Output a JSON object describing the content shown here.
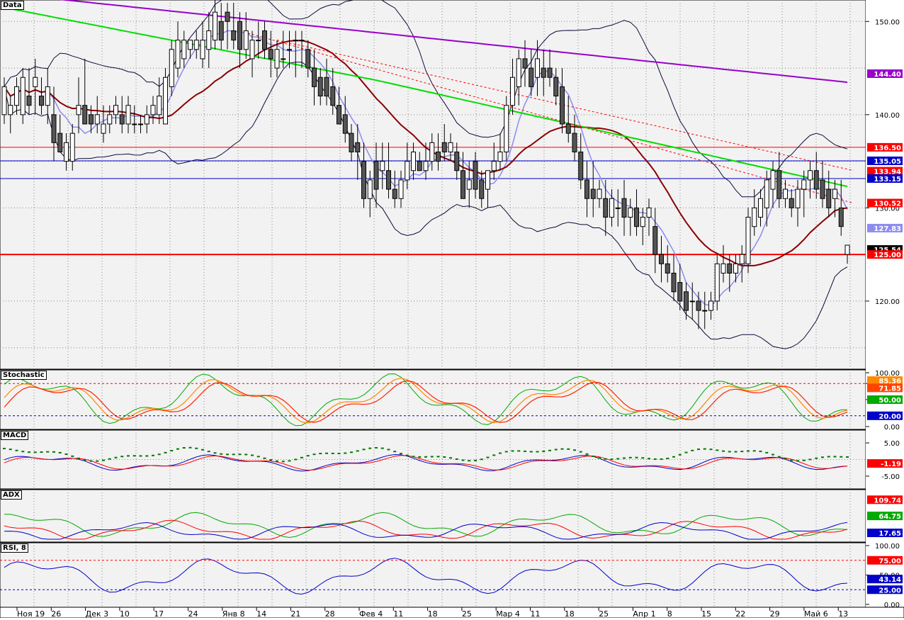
{
  "colors": {
    "background": "#f2f2f2",
    "bull": "#ffffff",
    "bear": "#555555",
    "bb": "#0a0a3a",
    "ma_fast": "#8c8cf0",
    "ma_mid": "#8b0000",
    "ma_slow": "#00dd00",
    "ma_long": "#9900cc"
  },
  "x_axis": {
    "labels": [
      "Ноя 19",
      "26",
      "Дек 3",
      "10",
      "17",
      "24",
      "Янв 8",
      "14",
      "21",
      "28",
      "Фев 4",
      "11",
      "18",
      "25",
      "Мар 4",
      "11",
      "18",
      "25",
      "Апр 1",
      "8",
      "15",
      "22",
      "29",
      "Май 6",
      "13"
    ]
  },
  "panels": {
    "data": {
      "title": "Data"
    },
    "stochastic": {
      "title": "Stochastic"
    },
    "macd": {
      "title": "MACD"
    },
    "adx": {
      "title": "ADX"
    },
    "rsi": {
      "title": "RSI, 8"
    }
  },
  "chart_data": [
    {
      "type": "candlestick",
      "panel": "Data",
      "ylim": [
        113,
        152
      ],
      "y_ticks": [
        "120.00",
        "130.00",
        "140.00",
        "150.00"
      ],
      "ohlc": [
        [
          140,
          144,
          139,
          143
        ],
        [
          140,
          142,
          138,
          141
        ],
        [
          141,
          144,
          140,
          143
        ],
        [
          140,
          145,
          139,
          144
        ],
        [
          142,
          145,
          140,
          141
        ],
        [
          143,
          146,
          140,
          144
        ],
        [
          142,
          144,
          140,
          141
        ],
        [
          141,
          145,
          139,
          143
        ],
        [
          140,
          143,
          135,
          137
        ],
        [
          138,
          140,
          136,
          136
        ],
        [
          135,
          138,
          134,
          137
        ],
        [
          135,
          139,
          134,
          138
        ],
        [
          140,
          144,
          138,
          141
        ],
        [
          141,
          146,
          139,
          139
        ],
        [
          140,
          141,
          138,
          139
        ],
        [
          139,
          142,
          138,
          140
        ],
        [
          138,
          141,
          137,
          139
        ],
        [
          139,
          141,
          138,
          140
        ],
        [
          140,
          142,
          139,
          141
        ],
        [
          140,
          142,
          138,
          139
        ],
        [
          139,
          142,
          138,
          141
        ],
        [
          139,
          141,
          138,
          139
        ],
        [
          139,
          140,
          138,
          139
        ],
        [
          139,
          141,
          138,
          140
        ],
        [
          140,
          142,
          139,
          141
        ],
        [
          140,
          144,
          139,
          142
        ],
        [
          139,
          145,
          139,
          144
        ],
        [
          143,
          148,
          142,
          147
        ],
        [
          145,
          150,
          144,
          148
        ],
        [
          146,
          149,
          145,
          148
        ],
        [
          147,
          148,
          146,
          148
        ],
        [
          147,
          149,
          146,
          148
        ],
        [
          146,
          150,
          145,
          148
        ],
        [
          147,
          151,
          145,
          149
        ],
        [
          148,
          153,
          147,
          151
        ],
        [
          150,
          152,
          147,
          148
        ],
        [
          151,
          152,
          147,
          150
        ],
        [
          149,
          152,
          147,
          148
        ],
        [
          150,
          151,
          145,
          147
        ],
        [
          147,
          151,
          146,
          149
        ],
        [
          146,
          149,
          144,
          148
        ],
        [
          148,
          150,
          146,
          148
        ],
        [
          149,
          150,
          146,
          147
        ],
        [
          147,
          149,
          144,
          146
        ],
        [
          145,
          148,
          144,
          147
        ],
        [
          146,
          149,
          145,
          146
        ],
        [
          147,
          149,
          145,
          147
        ],
        [
          148,
          149,
          144,
          148
        ],
        [
          148,
          149,
          145,
          148
        ],
        [
          147,
          148,
          144,
          145
        ],
        [
          145,
          147,
          141,
          143
        ],
        [
          144,
          145,
          141,
          142
        ],
        [
          144,
          146,
          141,
          142
        ],
        [
          143,
          145,
          140,
          141
        ],
        [
          141,
          143,
          139,
          139
        ],
        [
          140,
          142,
          137,
          138
        ],
        [
          138,
          139,
          135,
          136
        ],
        [
          137,
          139,
          133,
          136
        ],
        [
          135,
          137,
          130,
          131
        ],
        [
          131,
          134,
          129,
          133
        ],
        [
          135,
          137,
          130,
          132
        ],
        [
          134,
          137,
          132,
          135
        ],
        [
          134,
          137,
          131,
          132
        ],
        [
          132,
          134,
          130,
          131
        ],
        [
          131,
          134,
          130,
          133
        ],
        [
          133,
          137,
          132,
          135
        ],
        [
          134,
          137,
          133,
          136
        ],
        [
          135,
          136,
          134,
          134
        ],
        [
          134,
          137,
          133,
          135
        ],
        [
          135,
          138,
          134,
          137
        ],
        [
          136,
          138,
          134,
          135
        ],
        [
          137,
          139,
          135,
          136
        ],
        [
          136,
          138,
          135,
          137
        ],
        [
          136,
          137,
          133,
          134
        ],
        [
          134,
          136,
          131,
          131
        ],
        [
          132,
          135,
          130,
          133
        ],
        [
          135,
          136,
          131,
          132
        ],
        [
          133,
          134,
          130,
          131
        ],
        [
          132,
          134,
          130,
          134
        ],
        [
          134,
          137,
          133,
          135
        ],
        [
          135,
          138,
          134,
          136
        ],
        [
          136,
          142,
          135,
          141
        ],
        [
          141,
          146,
          140,
          144
        ],
        [
          143,
          147,
          141,
          146
        ],
        [
          146,
          148,
          143,
          145
        ],
        [
          145,
          147,
          142,
          143
        ],
        [
          144,
          148,
          142,
          146
        ],
        [
          145,
          147,
          142,
          144
        ],
        [
          145,
          147,
          143,
          144
        ],
        [
          144,
          145,
          141,
          142
        ],
        [
          143,
          145,
          138,
          139
        ],
        [
          139,
          142,
          137,
          138
        ],
        [
          138,
          140,
          135,
          136
        ],
        [
          136,
          138,
          132,
          133
        ],
        [
          133,
          135,
          129,
          131
        ],
        [
          132,
          135,
          129,
          131
        ],
        [
          131,
          133,
          130,
          132
        ],
        [
          131,
          133,
          127,
          129
        ],
        [
          129,
          132,
          128,
          131
        ],
        [
          130,
          132,
          128,
          130
        ],
        [
          131,
          133,
          127,
          129
        ],
        [
          129,
          131,
          127,
          130
        ],
        [
          130,
          132,
          127,
          128
        ],
        [
          128,
          130,
          126,
          129
        ],
        [
          129,
          131,
          127,
          130
        ],
        [
          128,
          130,
          123,
          125
        ],
        [
          125,
          127,
          122,
          124
        ],
        [
          124,
          126,
          122,
          123
        ],
        [
          123,
          125,
          120,
          121
        ],
        [
          122,
          124,
          119,
          120
        ],
        [
          121,
          122,
          118,
          119
        ],
        [
          120,
          122,
          118,
          120
        ],
        [
          120,
          121,
          117,
          119
        ],
        [
          119,
          121,
          117,
          119
        ],
        [
          119,
          121,
          118,
          120
        ],
        [
          120,
          125,
          119,
          124
        ],
        [
          123,
          126,
          122,
          124
        ],
        [
          124,
          125,
          121,
          123
        ],
        [
          123,
          125,
          122,
          124
        ],
        [
          124,
          126,
          122,
          125
        ],
        [
          124,
          130,
          123,
          129
        ],
        [
          128,
          132,
          127,
          130
        ],
        [
          129,
          132,
          128,
          131
        ],
        [
          130,
          134,
          128,
          133
        ],
        [
          132,
          135,
          130,
          134
        ],
        [
          134,
          136,
          130,
          131
        ],
        [
          131,
          133,
          130,
          132
        ],
        [
          131,
          132,
          129,
          130
        ],
        [
          130,
          133,
          128,
          132
        ],
        [
          132,
          134,
          129,
          133
        ],
        [
          133,
          135,
          131,
          134
        ],
        [
          134,
          136,
          131,
          132
        ],
        [
          133,
          135,
          130,
          131
        ],
        [
          132,
          134,
          129,
          130
        ],
        [
          131,
          133,
          129,
          132
        ],
        [
          130,
          133,
          127,
          128
        ],
        [
          125,
          126,
          124,
          126
        ]
      ],
      "overlays": [
        "bollinger",
        "ma_fast",
        "ma_mid",
        "ma_slow",
        "ma_long",
        "trend_lines"
      ],
      "level_labels": [
        {
          "value": "144.40",
          "color": "#9900cc"
        },
        {
          "value": "136.50",
          "color": "#ff0000"
        },
        {
          "value": "135.05",
          "color": "#0000c8"
        },
        {
          "value": "133.94",
          "color": "#ff0000"
        },
        {
          "value": "133.15",
          "color": "#0000c8"
        },
        {
          "value": "130.52",
          "color": "#ff0000"
        },
        {
          "value": "127.83",
          "color": "#8c8cf0"
        },
        {
          "value": "125.54",
          "color": "#000000"
        },
        {
          "value": "125.00",
          "color": "#ff0000"
        }
      ]
    },
    {
      "type": "line",
      "panel": "Stochastic",
      "ylim": [
        0,
        100
      ],
      "y_ticks": [
        "100.00",
        "80.00",
        "50.00",
        "0.00"
      ],
      "levels": [
        80,
        20
      ],
      "value_labels": [
        {
          "value": "85.36",
          "color": "#ff8800"
        },
        {
          "value": "71.85",
          "color": "#ff4400"
        },
        {
          "value": "50.00",
          "color": "#00aa00"
        },
        {
          "value": "20.00",
          "color": "#0000c8"
        }
      ]
    },
    {
      "type": "line",
      "panel": "MACD",
      "ylim": [
        -8,
        8
      ],
      "y_ticks": [
        "5.00",
        "-5.00"
      ],
      "value_labels": [
        {
          "value": "-1.19",
          "color": "#ff0000"
        }
      ]
    },
    {
      "type": "line",
      "panel": "ADX",
      "ylim": [
        0,
        130
      ],
      "value_labels": [
        {
          "value": "109.74",
          "color": "#ff0000"
        },
        {
          "value": "64.75",
          "color": "#00aa00"
        },
        {
          "value": "17.65",
          "color": "#0000c8"
        }
      ]
    },
    {
      "type": "line",
      "panel": "RSI, 8",
      "ylim": [
        0,
        100
      ],
      "y_ticks": [
        "100.00",
        "50.00",
        "0.00"
      ],
      "levels": [
        75,
        25
      ],
      "value_labels": [
        {
          "value": "75.00",
          "color": "#ff0000"
        },
        {
          "value": "43.14",
          "color": "#0000c8"
        },
        {
          "value": "25.00",
          "color": "#0000c8"
        }
      ]
    }
  ]
}
